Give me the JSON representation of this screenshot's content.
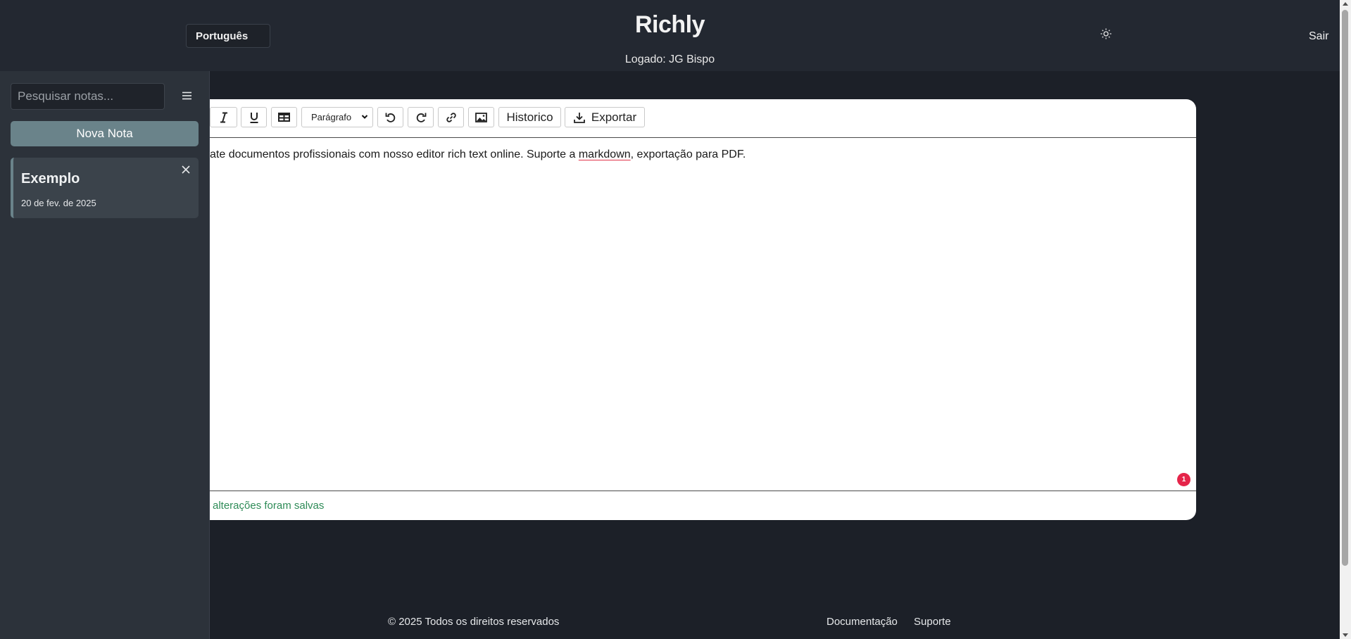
{
  "header": {
    "language": "Português",
    "title": "Richly",
    "logged_in": "Logado: JG Bispo",
    "theme_icon": "sun-icon",
    "logout": "Sair"
  },
  "sidebar": {
    "search_placeholder": "Pesquisar notas...",
    "new_note": "Nova Nota",
    "notes": [
      {
        "title": "Exemplo",
        "date": "20 de fev. de 2025"
      }
    ]
  },
  "editor": {
    "block_format": "Parágrafo",
    "history": "Historico",
    "export": "Exportar",
    "content_before": "ate documentos profissionais com nosso editor rich text online. Suporte a ",
    "content_misspelled": "markdown",
    "content_after": ", exportação para PDF.",
    "badge_count": "1",
    "save_status": "alterações foram salvas"
  },
  "footer": {
    "copyright": "© 2025 Todos os direitos reservados",
    "docs": "Documentação",
    "support": "Suporte"
  },
  "colors": {
    "accent": "#6a838a",
    "badge": "#e5254a",
    "saved": "#2e8b57"
  }
}
